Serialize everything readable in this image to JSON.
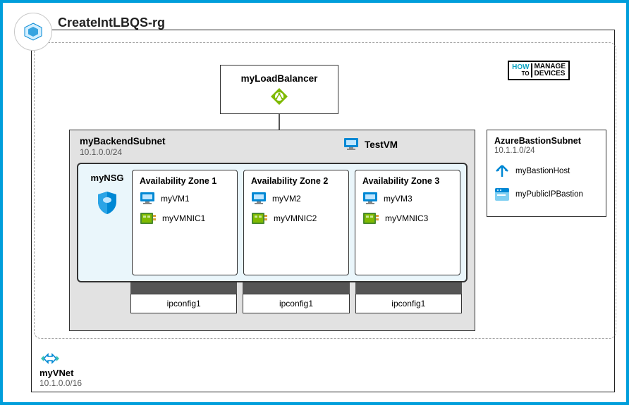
{
  "resource_group": {
    "name": "CreateIntLBQS-rg"
  },
  "badge": {
    "line1": "HOW",
    "line2": "TO",
    "box": "MANAGE",
    "box2": "DEVICES"
  },
  "load_balancer": {
    "name": "myLoadBalancer"
  },
  "backend_subnet": {
    "title": "myBackendSubnet",
    "cidr": "10.1.0.0/24",
    "test_vm": "TestVM",
    "nsg": {
      "title": "myNSG"
    },
    "zones": [
      {
        "title": "Availability Zone 1",
        "vm": "myVM1",
        "nic": "myVMNIC1",
        "ipconfig": "ipconfig1"
      },
      {
        "title": "Availability Zone 2",
        "vm": "myVM2",
        "nic": "myVMNIC2",
        "ipconfig": "ipconfig1"
      },
      {
        "title": "Availability Zone 3",
        "vm": "myVM3",
        "nic": "myVMNIC3",
        "ipconfig": "ipconfig1"
      }
    ]
  },
  "bastion_subnet": {
    "title": "AzureBastionSubnet",
    "cidr": "10.1.1.0/24",
    "host": "myBastionHost",
    "publicip": "myPublicIPBastion"
  },
  "vnet": {
    "name": "myVNet",
    "cidr": "10.1.0.0/16"
  },
  "colors": {
    "azure_blue": "#0088d4",
    "accent_green": "#7fba00"
  }
}
